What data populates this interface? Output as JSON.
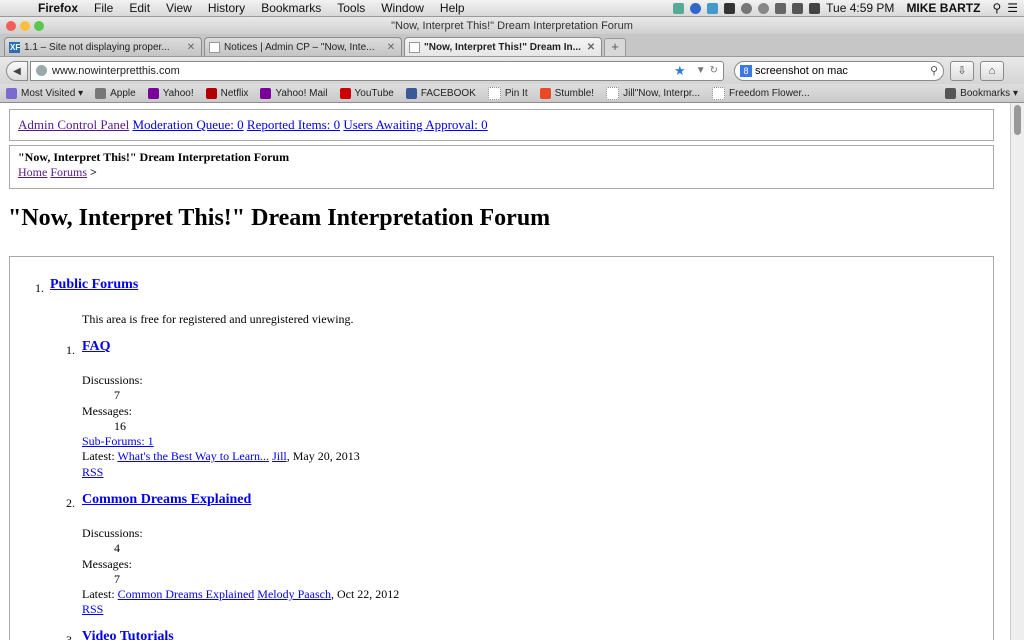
{
  "menubar": {
    "app": "Firefox",
    "items": [
      "File",
      "Edit",
      "View",
      "History",
      "Bookmarks",
      "Tools",
      "Window",
      "Help"
    ],
    "clock": "Tue 4:59 PM",
    "user": "MIKE BARTZ"
  },
  "window": {
    "title": "\"Now, Interpret This!\" Dream Interpretation Forum"
  },
  "tabs": [
    {
      "label": "1.1 – Site not displaying proper..."
    },
    {
      "label": "Notices | Admin CP – \"Now, Inte..."
    },
    {
      "label": "\"Now, Interpret This!\" Dream In..."
    }
  ],
  "nav": {
    "url": "www.nowinterpretthis.com",
    "search_value": "screenshot on mac"
  },
  "bookmarks": [
    {
      "label": "Most Visited",
      "color": "#7a6bd0"
    },
    {
      "label": "Apple",
      "color": "#777777"
    },
    {
      "label": "Yahoo!",
      "color": "#7b0099"
    },
    {
      "label": "Netflix",
      "color": "#b00000"
    },
    {
      "label": "Yahoo! Mail",
      "color": "#7b0099"
    },
    {
      "label": "YouTube",
      "color": "#cc0000"
    },
    {
      "label": "FACEBOOK",
      "color": "#3b5998"
    },
    {
      "label": "Pin It",
      "color": "#ffffff"
    },
    {
      "label": "Stumble!",
      "color": "#eb4924"
    },
    {
      "label": "Jill\"Now, Interpr...",
      "color": "#ffffff"
    },
    {
      "label": "Freedom Flower...",
      "color": "#ffffff"
    }
  ],
  "bookmarks_menu": "Bookmarks",
  "page": {
    "admin_links": [
      "Admin Control Panel",
      "Moderation Queue: 0",
      "Reported Items: 0",
      "Users Awaiting Approval: 0"
    ],
    "crumb_title": "\"Now, Interpret This!\" Dream Interpretation Forum",
    "crumb_home": "Home",
    "crumb_forums": "Forums",
    "crumb_sep": ">",
    "heading": "\"Now, Interpret This!\" Dream Interpretation Forum",
    "category": {
      "num": "1.",
      "title": "Public Forums",
      "desc": "This area is free for registered and unregistered viewing."
    },
    "forums": [
      {
        "num": "1.",
        "title": "FAQ",
        "discussions_label": "Discussions:",
        "discussions": "7",
        "messages_label": "Messages:",
        "messages": "16",
        "subforums": "Sub-Forums: 1",
        "latest_label": "Latest:",
        "latest_thread": "What's the Best Way to Learn...",
        "latest_user": "Jill",
        "latest_date": ", May 20, 2013",
        "rss": "RSS"
      },
      {
        "num": "2.",
        "title": "Common Dreams Explained",
        "discussions_label": "Discussions:",
        "discussions": "4",
        "messages_label": "Messages:",
        "messages": "7",
        "latest_label": "Latest:",
        "latest_thread": "Common Dreams Explained",
        "latest_user": "Melody Paasch",
        "latest_date": ", Oct 22, 2012",
        "rss": "RSS"
      },
      {
        "num": "3.",
        "title": "Video Tutorials"
      }
    ]
  }
}
